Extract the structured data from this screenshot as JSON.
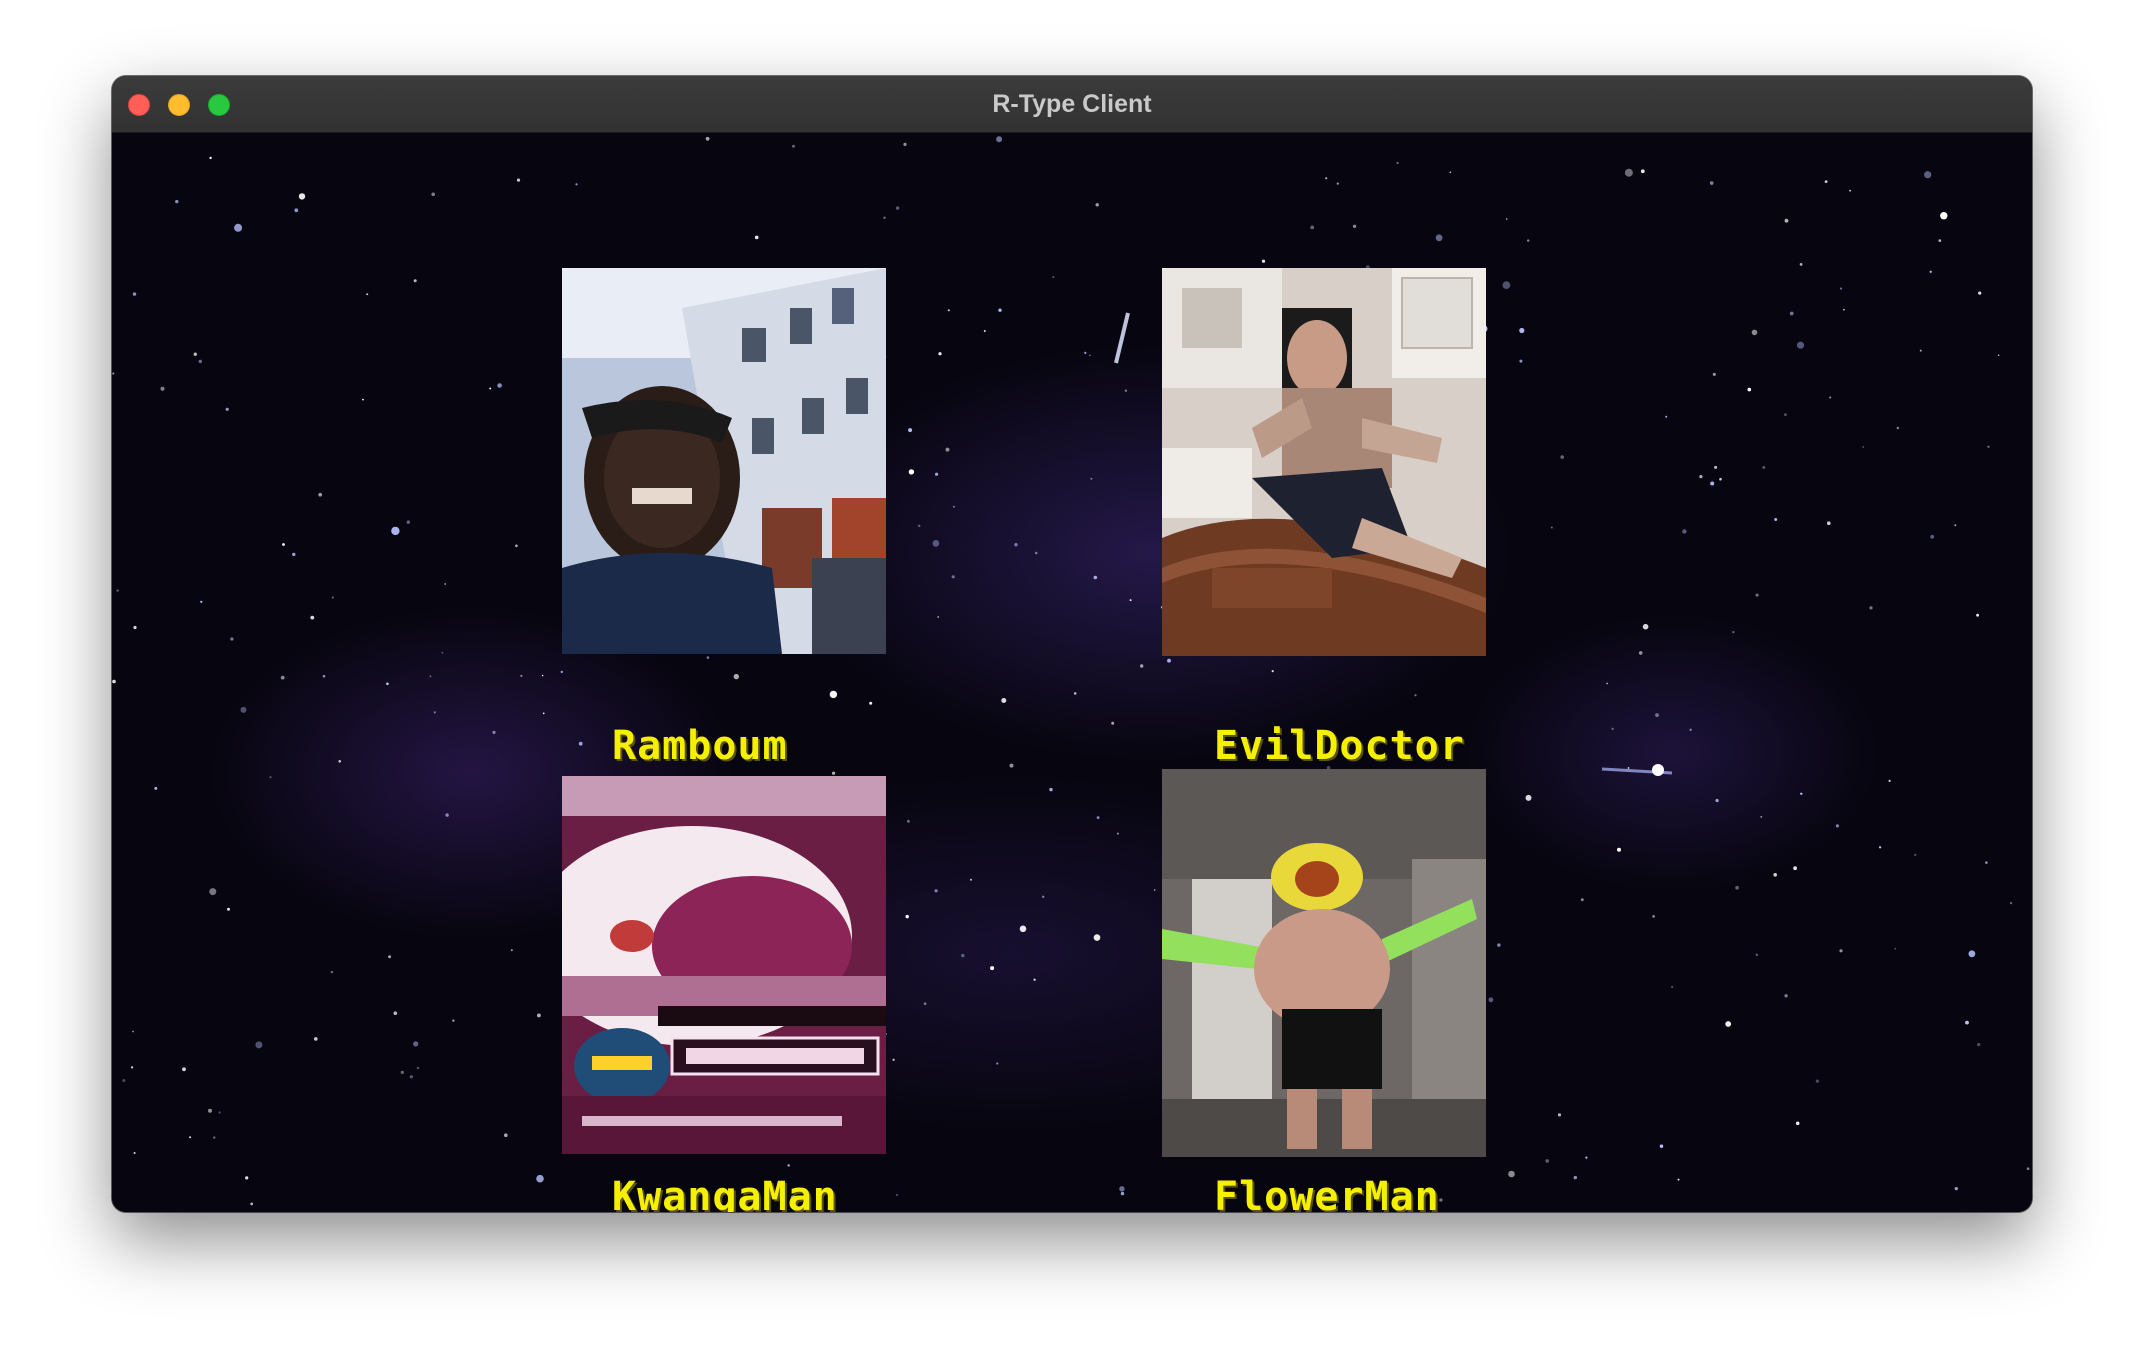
{
  "window": {
    "title": "R-Type Client"
  },
  "characters": [
    {
      "name": "Ramboum",
      "portrait_icon": "photo-man-street-icon"
    },
    {
      "name": "EvilDoctor",
      "portrait_icon": "photo-doctor-table-icon"
    },
    {
      "name": "KwangaMan",
      "portrait_icon": "photo-food-screenshot-icon"
    },
    {
      "name": "FlowerMan",
      "portrait_icon": "photo-flower-head-icon"
    }
  ],
  "colors": {
    "name_text": "#f4f000",
    "background": "#07050f",
    "titlebar": "#363636"
  }
}
